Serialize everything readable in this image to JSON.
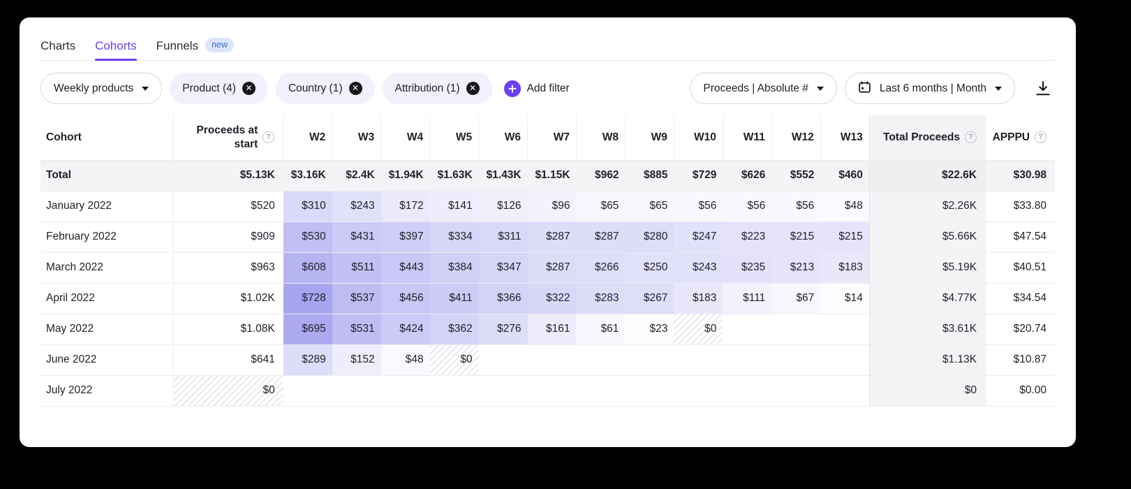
{
  "tabs": [
    {
      "label": "Charts",
      "active": false,
      "badge": null
    },
    {
      "label": "Cohorts",
      "active": true,
      "badge": null
    },
    {
      "label": "Funnels",
      "active": false,
      "badge": "new"
    }
  ],
  "toolbar": {
    "dataset_select": "Weekly products",
    "chips": [
      {
        "label": "Product (4)"
      },
      {
        "label": "Country (1)"
      },
      {
        "label": "Attribution (1)"
      }
    ],
    "add_filter_label": "Add filter",
    "metric_select": "Proceeds | Absolute #",
    "date_select": "Last 6 months | Month",
    "download_label": "download-report"
  },
  "accent_color": "#6c3ef4",
  "heat_color": "#6f6ae6",
  "table": {
    "columns": {
      "cohort": "Cohort",
      "start_line1": "Proceeds at",
      "start_line2": "start",
      "weeks": [
        "W2",
        "W3",
        "W4",
        "W5",
        "W6",
        "W7",
        "W8",
        "W9",
        "W10",
        "W11",
        "W12",
        "W13"
      ],
      "total": "Total Proceeds",
      "apppu": "APPPU"
    },
    "rows": [
      {
        "cohort": "Total",
        "is_total": true,
        "start": "$5.13K",
        "start_hatch": false,
        "weeks": [
          "$3.16K",
          "$2.4K",
          "$1.94K",
          "$1.63K",
          "$1.43K",
          "$1.15K",
          "$962",
          "$885",
          "$729",
          "$626",
          "$552",
          "$460"
        ],
        "heat": [
          0,
          0,
          0,
          0,
          0,
          0,
          0,
          0,
          0,
          0,
          0,
          0
        ],
        "hatch": [
          false,
          false,
          false,
          false,
          false,
          false,
          false,
          false,
          false,
          false,
          false,
          false
        ],
        "total": "$22.6K",
        "apppu": "$30.98"
      },
      {
        "cohort": "January 2022",
        "is_total": false,
        "start": "$520",
        "start_hatch": false,
        "weeks": [
          "$310",
          "$243",
          "$172",
          "$141",
          "$126",
          "$96",
          "$65",
          "$65",
          "$56",
          "$56",
          "$56",
          "$48"
        ],
        "heat": [
          0.41,
          0.32,
          0.23,
          0.19,
          0.17,
          0.13,
          0.09,
          0.09,
          0.08,
          0.08,
          0.08,
          0.07
        ],
        "hatch": [
          false,
          false,
          false,
          false,
          false,
          false,
          false,
          false,
          false,
          false,
          false,
          false
        ],
        "total": "$2.26K",
        "apppu": "$33.80"
      },
      {
        "cohort": "February 2022",
        "is_total": false,
        "start": "$909",
        "start_hatch": false,
        "weeks": [
          "$530",
          "$431",
          "$397",
          "$334",
          "$311",
          "$287",
          "$287",
          "$280",
          "$247",
          "$223",
          "$215",
          "$215"
        ],
        "heat": [
          0.7,
          0.57,
          0.53,
          0.45,
          0.42,
          0.38,
          0.38,
          0.38,
          0.33,
          0.3,
          0.29,
          0.29
        ],
        "hatch": [
          false,
          false,
          false,
          false,
          false,
          false,
          false,
          false,
          false,
          false,
          false,
          false
        ],
        "total": "$5.66K",
        "apppu": "$47.54"
      },
      {
        "cohort": "March 2022",
        "is_total": false,
        "start": "$963",
        "start_hatch": false,
        "weeks": [
          "$608",
          "$511",
          "$443",
          "$384",
          "$347",
          "$287",
          "$266",
          "$250",
          "$243",
          "$235",
          "$213",
          "$183"
        ],
        "heat": [
          0.81,
          0.68,
          0.59,
          0.51,
          0.46,
          0.38,
          0.36,
          0.33,
          0.32,
          0.31,
          0.29,
          0.25
        ],
        "hatch": [
          false,
          false,
          false,
          false,
          false,
          false,
          false,
          false,
          false,
          false,
          false,
          false
        ],
        "total": "$5.19K",
        "apppu": "$40.51"
      },
      {
        "cohort": "April 2022",
        "is_total": false,
        "start": "$1.02K",
        "start_hatch": false,
        "weeks": [
          "$728",
          "$537",
          "$456",
          "$411",
          "$366",
          "$322",
          "$283",
          "$267",
          "$183",
          "$111",
          "$67",
          "$14"
        ],
        "heat": [
          0.97,
          0.72,
          0.61,
          0.55,
          0.49,
          0.43,
          0.38,
          0.36,
          0.25,
          0.15,
          0.09,
          0.02
        ],
        "hatch": [
          false,
          false,
          false,
          false,
          false,
          false,
          false,
          false,
          false,
          false,
          false,
          false
        ],
        "total": "$4.77K",
        "apppu": "$34.54"
      },
      {
        "cohort": "May 2022",
        "is_total": false,
        "start": "$1.08K",
        "start_hatch": false,
        "weeks": [
          "$695",
          "$531",
          "$424",
          "$362",
          "$276",
          "$161",
          "$61",
          "$23",
          "$0",
          null,
          null,
          null
        ],
        "heat": [
          0.93,
          0.71,
          0.57,
          0.48,
          0.37,
          0.21,
          0.08,
          0.03,
          0,
          0,
          0,
          0
        ],
        "hatch": [
          false,
          false,
          false,
          false,
          false,
          false,
          false,
          false,
          true,
          false,
          false,
          false
        ],
        "total": "$3.61K",
        "apppu": "$20.74"
      },
      {
        "cohort": "June 2022",
        "is_total": false,
        "start": "$641",
        "start_hatch": false,
        "weeks": [
          "$289",
          "$152",
          "$48",
          "$0",
          null,
          null,
          null,
          null,
          null,
          null,
          null,
          null
        ],
        "heat": [
          0.38,
          0.2,
          0.06,
          0,
          0,
          0,
          0,
          0,
          0,
          0,
          0,
          0
        ],
        "hatch": [
          false,
          false,
          false,
          true,
          false,
          false,
          false,
          false,
          false,
          false,
          false,
          false
        ],
        "total": "$1.13K",
        "apppu": "$10.87"
      },
      {
        "cohort": "July 2022",
        "is_total": false,
        "start": "$0",
        "start_hatch": true,
        "weeks": [
          null,
          null,
          null,
          null,
          null,
          null,
          null,
          null,
          null,
          null,
          null,
          null
        ],
        "heat": [
          0,
          0,
          0,
          0,
          0,
          0,
          0,
          0,
          0,
          0,
          0,
          0
        ],
        "hatch": [
          false,
          false,
          false,
          false,
          false,
          false,
          false,
          false,
          false,
          false,
          false,
          false
        ],
        "total": "$0",
        "apppu": "$0.00"
      }
    ]
  }
}
